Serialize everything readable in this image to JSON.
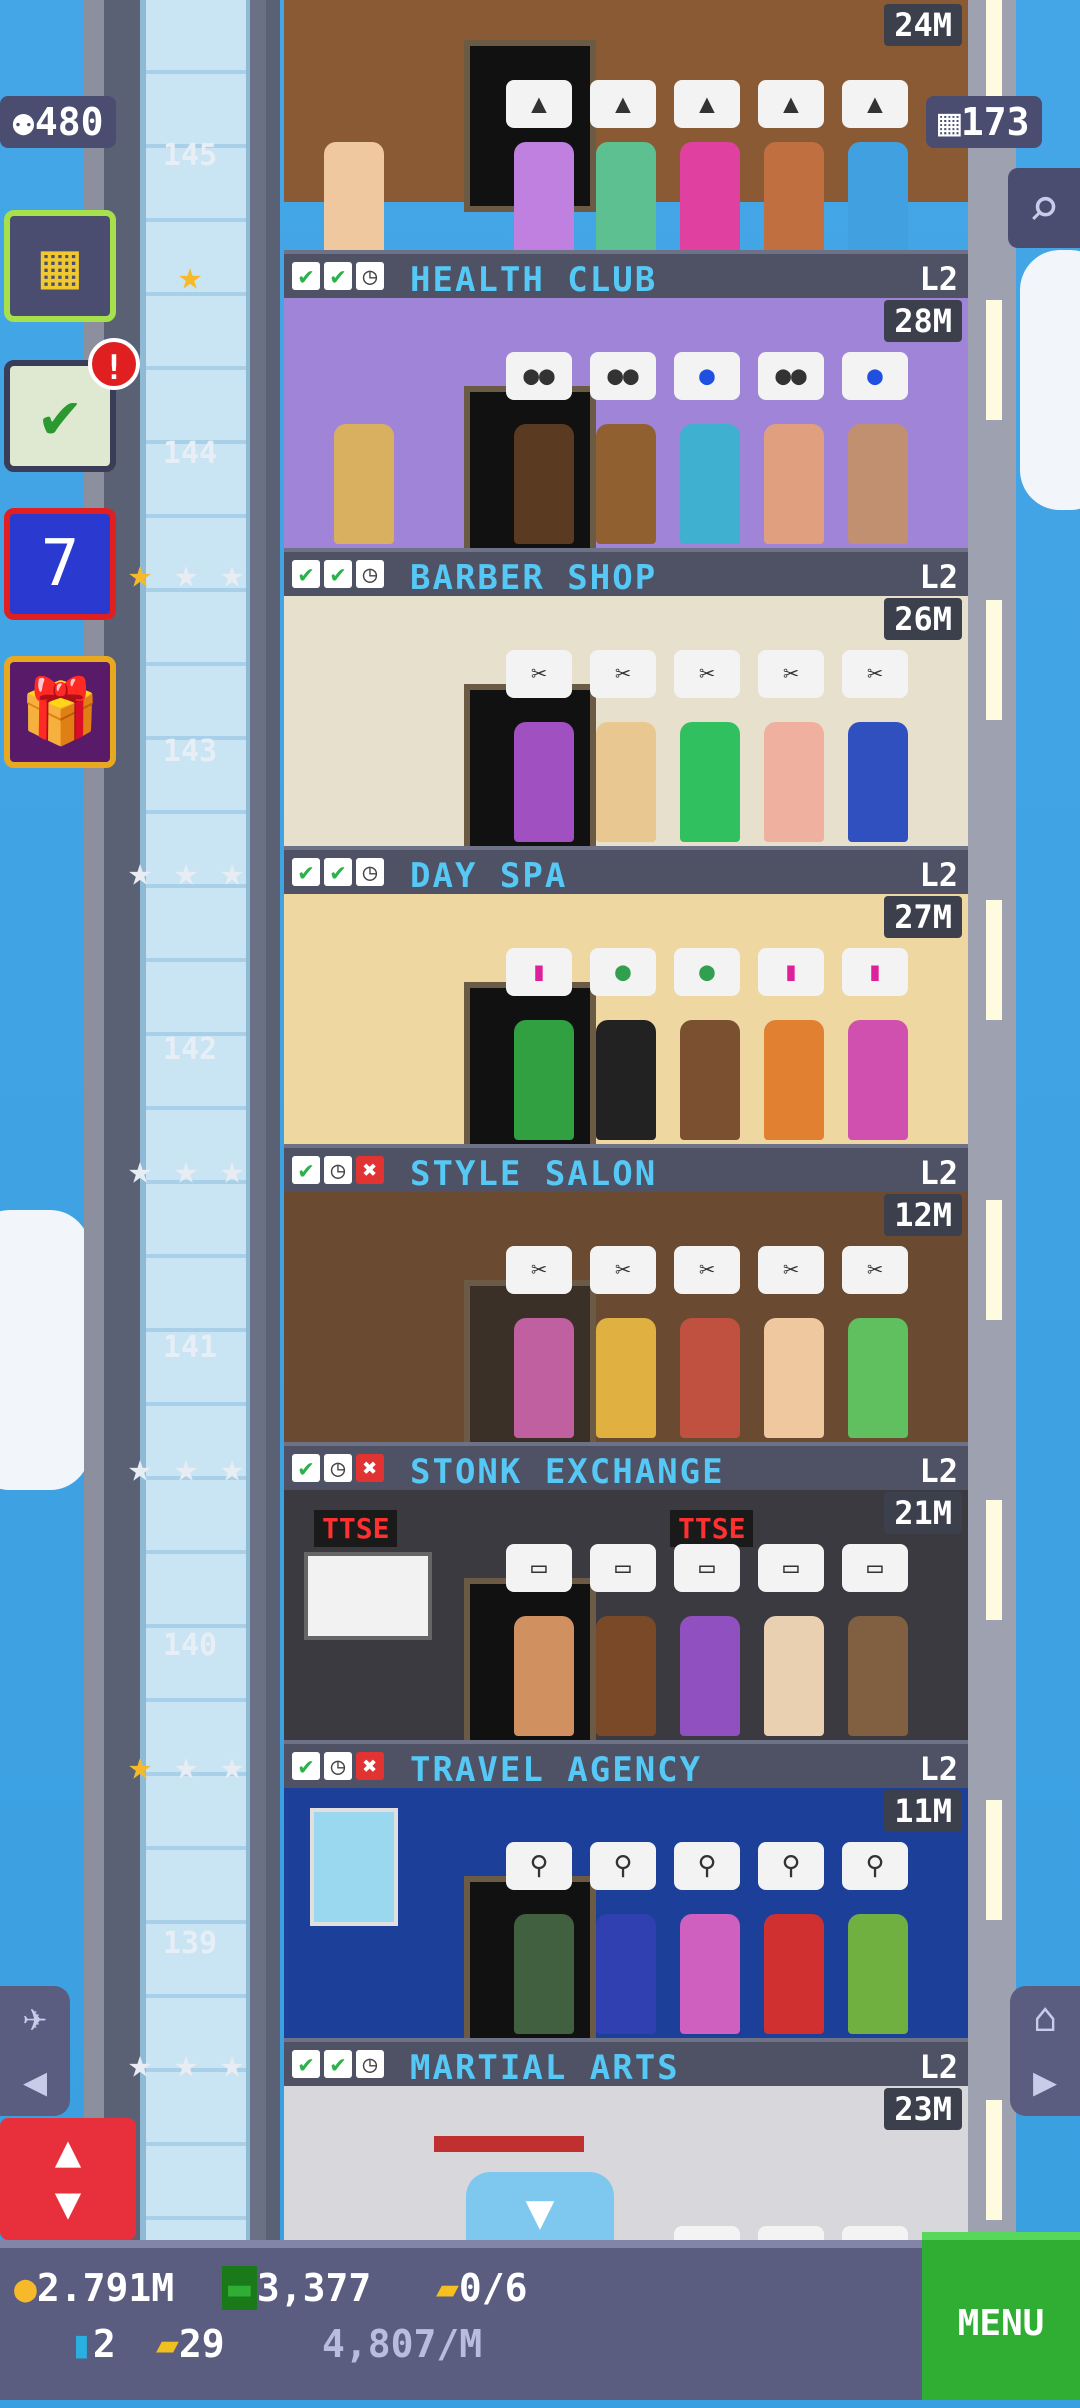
{
  "hud": {
    "population": "480",
    "floors": "173",
    "coins": "2.791M",
    "bux": "3,377",
    "vip_tickets": "0/6",
    "keys": "2",
    "golden_tickets": "29",
    "income_rate": "4,807/M",
    "menu_label": "MENU"
  },
  "floors": [
    {
      "number": "145",
      "name": "",
      "level": "",
      "timer": "24M",
      "room_color": "#8a5a34"
    },
    {
      "number": "144",
      "name": "HEALTH CLUB",
      "level": "L2",
      "timer": "28M",
      "room_color": "#a084d8"
    },
    {
      "number": "143",
      "name": "BARBER SHOP",
      "level": "L2",
      "timer": "26M",
      "room_color": "#e6e0cc"
    },
    {
      "number": "142",
      "name": "DAY SPA",
      "level": "L2",
      "timer": "27M",
      "room_color": "#eed7a0"
    },
    {
      "number": "141",
      "name": "STYLE SALON",
      "level": "L2",
      "timer": "12M",
      "room_color": "#6a4a30"
    },
    {
      "number": "140",
      "name": "STONK EXCHANGE",
      "level": "L2",
      "timer": "21M",
      "room_color": "#3a3a40"
    },
    {
      "number": "139",
      "name": "TRAVEL AGENCY",
      "level": "L2",
      "timer": "11M",
      "room_color": "#1c3f9a"
    },
    {
      "number": "",
      "name": "MARTIAL ARTS",
      "level": "L2",
      "timer": "23M",
      "room_color": "#d8d8dc"
    }
  ],
  "floor_signs": {
    "ttse": "TTSE"
  },
  "colors": {
    "sky": "#3a9fe0",
    "name_text": "#55c8f5",
    "menu": "#2fae33"
  }
}
